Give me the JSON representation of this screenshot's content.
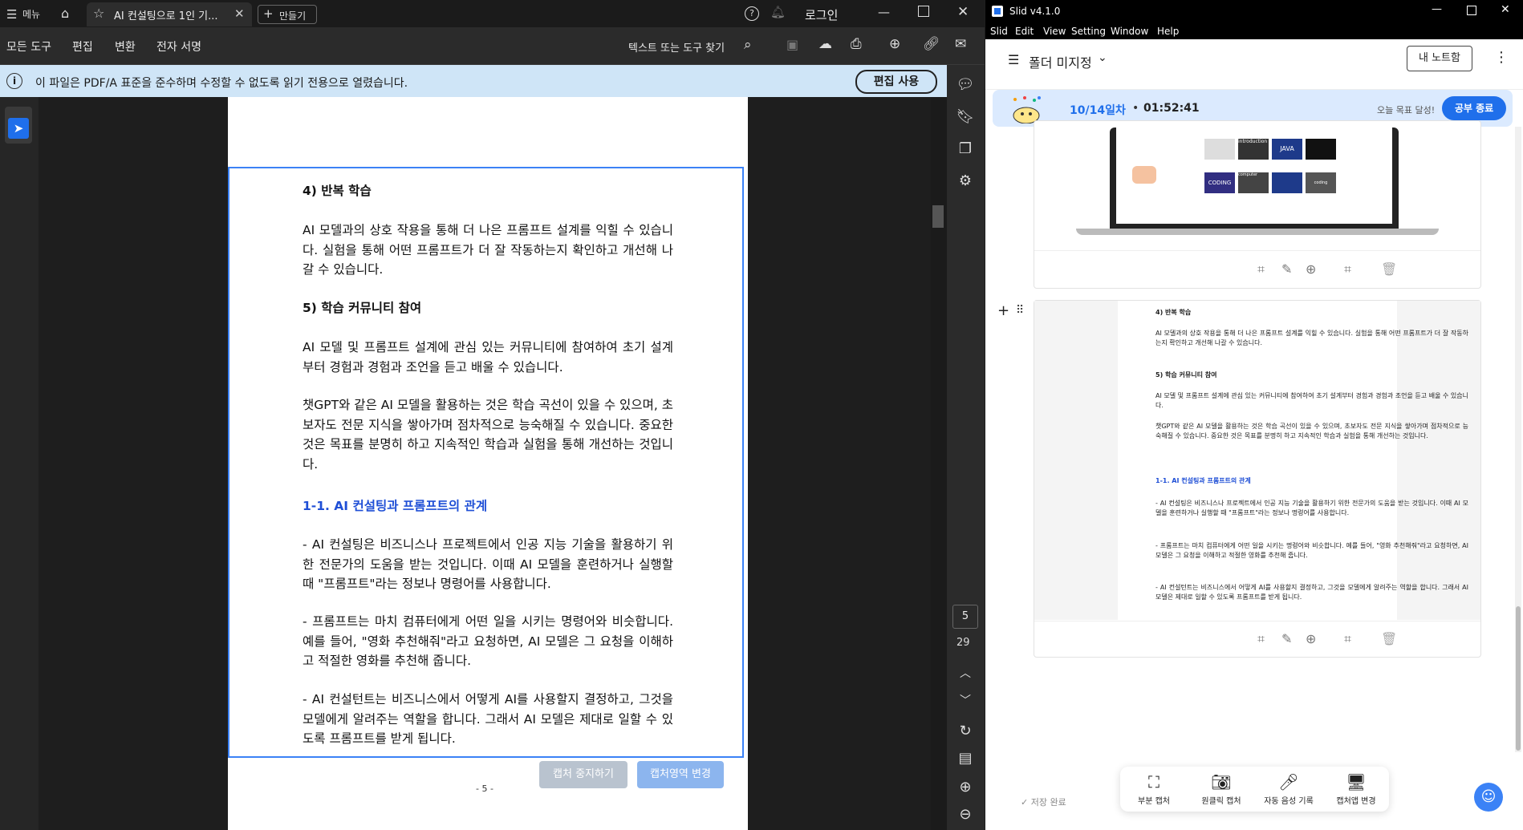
{
  "acrobat": {
    "menu_label": "메뉴",
    "tab_title": "AI 컨설팅으로 1인 기...",
    "new_tab_label": "만들기",
    "login_label": "로그인",
    "toolbar": {
      "all_tools": "모든 도구",
      "edit": "편집",
      "convert": "변환",
      "e_sign": "전자 서명",
      "search_placeholder": "텍스트 또는 도구 찾기"
    },
    "banner": {
      "message": "이 파일은 PDF/A 표준을 준수하며 수정할 수 없도록 읽기 전용으로 열렸습니다.",
      "enable_edit": "편집 사용"
    },
    "page": {
      "paragraphs": [
        {
          "style": "h",
          "text": "4) 반복 학습"
        },
        {
          "style": "p",
          "text": "AI 모델과의 상호 작용을 통해 더 나은 프롬프트 설계를 익힐 수 있습니다. 실험을 통해 어떤 프롬프트가 더 잘 작동하는지 확인하고 개선해 나갈 수 있습니다."
        },
        {
          "style": "h",
          "text": "5) 학습 커뮤니티 참여"
        },
        {
          "style": "p",
          "text": "AI 모델 및 프롬프트 설계에 관심 있는 커뮤니티에 참여하여 초기 설계부터 경험과 경험과 조언을 듣고 배울 수 있습니다."
        },
        {
          "style": "p",
          "text": "챗GPT와 같은 AI 모델을 활용하는 것은 학습 곡선이 있을 수 있으며, 초보자도 전문 지식을 쌓아가며 점차적으로 능숙해질 수 있습니다. 중요한 것은 목표를 분명히 하고 지속적인 학습과 실험을 통해 개선하는 것입니다."
        },
        {
          "style": "blue",
          "text": "1-1. AI 컨설팅과 프롬프트의 관계"
        },
        {
          "style": "p",
          "text": "- AI 컨설팅은 비즈니스나 프로젝트에서 인공 지능 기술을 활용하기 위한 전문가의 도움을 받는 것입니다. 이때 AI 모델을 훈련하거나 실행할 때 \"프롬프트\"라는 정보나 명령어를 사용합니다."
        },
        {
          "style": "p",
          "text": "- 프롬프트는 마치 컴퓨터에게 어떤 일을 시키는 명령어와 비슷합니다. 예를 들어, \"영화 추천해줘\"라고 요청하면, AI 모델은 그 요청을 이해하고 적절한 영화를 추천해 줍니다."
        },
        {
          "style": "p",
          "text": "- AI 컨설턴트는 비즈니스에서 어떻게 AI를 사용할지 결정하고, 그것을 모델에게 알려주는 역할을 합니다. 그래서 AI 모델은 제대로 일할 수 있도록 프롬프트를 받게 됩니다."
        }
      ],
      "page_number_label": "- 5 -"
    },
    "capture": {
      "stop_label": "캡처 중지하기",
      "change_label": "캡처영역 변경"
    },
    "page_nav": {
      "current": "5",
      "total": "29"
    }
  },
  "slid": {
    "window_title": "Slid v4.1.0",
    "menu": [
      "Slid",
      "Edit",
      "View",
      "Setting",
      "Window",
      "Help"
    ],
    "folder_label": "폴더 미지정",
    "my_notes_label": "내 노트함",
    "study": {
      "day_label": "10/14일차",
      "timer": "01:52:41",
      "goal_text": "오늘 목표 달성!",
      "end_label": "공부 종료"
    },
    "thumb_tiles": [
      "introduction",
      "JAVA",
      "CODING",
      "computer",
      "coding"
    ],
    "save_status": "저장 완료",
    "bottom_bar": [
      {
        "label": "부분 캡처",
        "icon": "crop-icon"
      },
      {
        "label": "원클릭 캡처",
        "icon": "camera-icon"
      },
      {
        "label": "자동 음성 기록",
        "icon": "mic-icon"
      },
      {
        "label": "캡처앱 변경",
        "icon": "monitor-icon"
      }
    ]
  },
  "colors": {
    "accent_blue": "#1f6feb",
    "capture_border": "#3b82f6",
    "banner_bg": "#cfe5f7"
  }
}
